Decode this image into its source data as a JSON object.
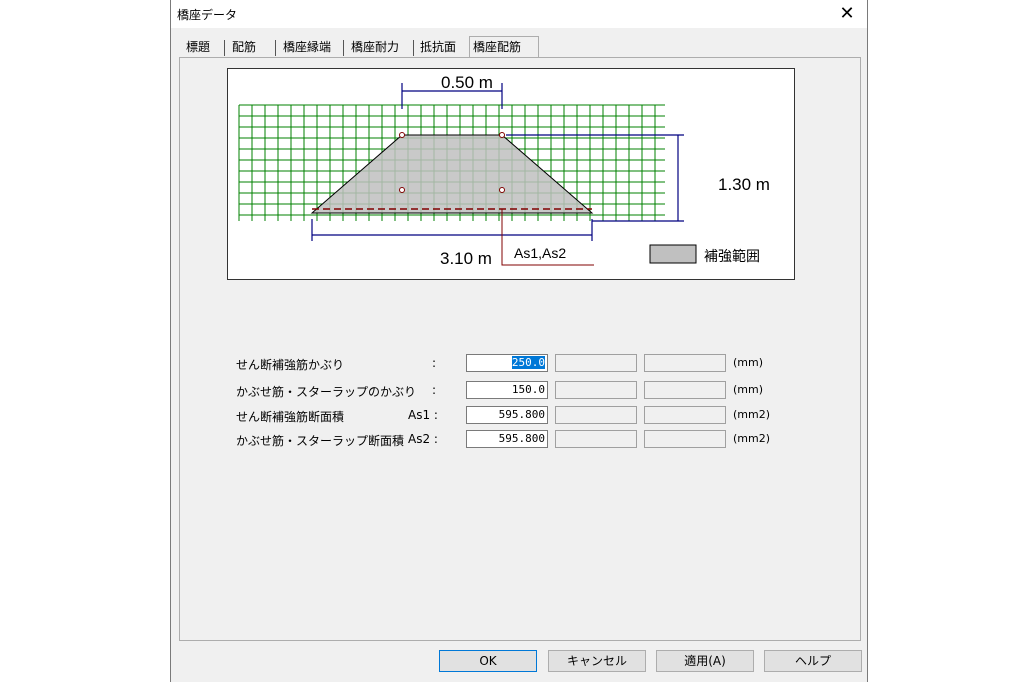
{
  "window": {
    "title": "橋座データ"
  },
  "tabs": [
    {
      "label": "標題"
    },
    {
      "label": "配筋"
    },
    {
      "label": "橋座縁端"
    },
    {
      "label": "橋座耐力"
    },
    {
      "label": "抵抗面"
    },
    {
      "label": "橋座配筋"
    }
  ],
  "active_tab": "橋座配筋",
  "diagram": {
    "top_width": "0.50 m",
    "height": "1.30 m",
    "bottom_width": "3.10 m",
    "rebar_label": "As1,As2",
    "legend_label": "補強範囲",
    "colors": {
      "grid": "#008000",
      "fill": "#c0c0c0",
      "dimension": "#000080",
      "rebar": "#800000"
    }
  },
  "fields": [
    {
      "label": "せん断補強筋かぶり",
      "symbol": ":",
      "value": "250.0",
      "unit": "(mm)"
    },
    {
      "label": "かぶせ筋・スターラップのかぶり",
      "symbol": ":",
      "value": "150.0",
      "unit": "(mm)"
    },
    {
      "label": "せん断補強筋断面積",
      "symbol": "As1 :",
      "value": "595.800",
      "unit": "(mm2)"
    },
    {
      "label": "かぶせ筋・スターラップ断面積",
      "symbol": "As2 :",
      "value": "595.800",
      "unit": "(mm2)"
    }
  ],
  "buttons": {
    "ok": "OK",
    "cancel": "キャンセル",
    "apply": "適用(A)",
    "help": "ヘルプ"
  }
}
